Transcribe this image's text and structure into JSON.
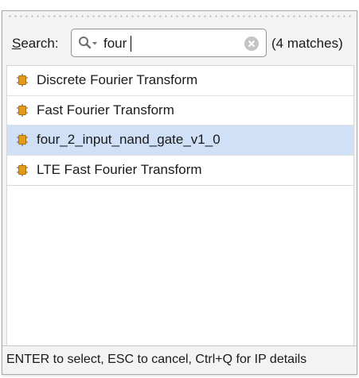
{
  "search": {
    "label": "Search:",
    "query": "four",
    "match_count": "(4 matches)"
  },
  "results": [
    {
      "label": "Discrete Fourier Transform",
      "icon": "ip-core-icon",
      "selected": false
    },
    {
      "label": "Fast Fourier Transform",
      "icon": "ip-core-icon",
      "selected": false
    },
    {
      "label": "four_2_input_nand_gate_v1_0",
      "icon": "ip-core-icon",
      "selected": true
    },
    {
      "label": "LTE Fast Fourier Transform",
      "icon": "ip-core-icon",
      "selected": false
    }
  ],
  "footer": {
    "hint": "ENTER to select, ESC to cancel, Ctrl+Q for IP details"
  },
  "colors": {
    "selection": "#cfe0f7",
    "icon_orange": "#e39a1c"
  }
}
